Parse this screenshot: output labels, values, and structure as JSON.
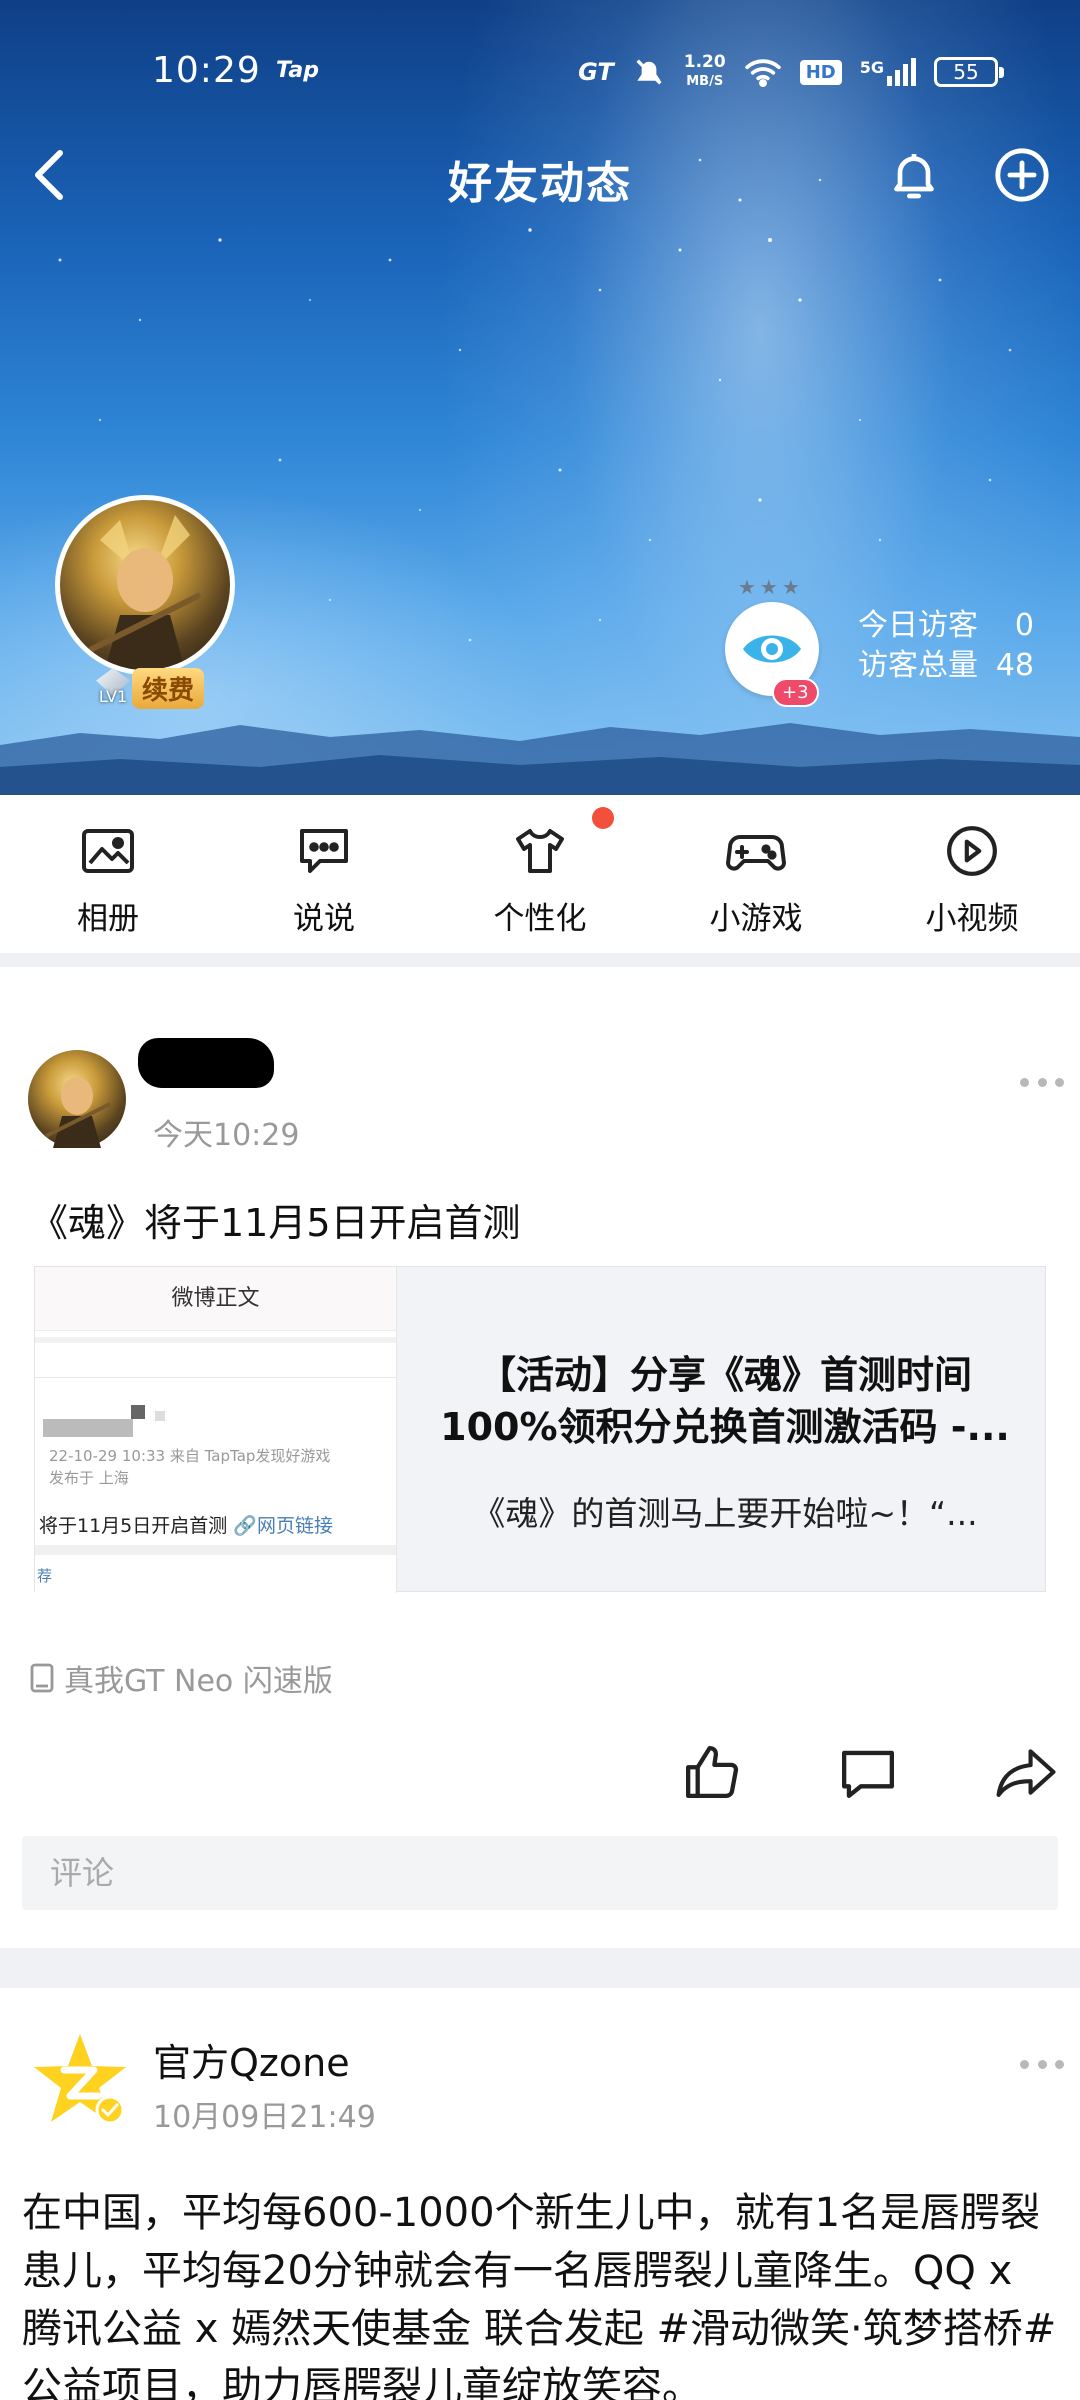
{
  "status_bar": {
    "time": "10:29",
    "app_tag": "Tap",
    "gt_label": "GT",
    "net_speed_value": "1.20",
    "net_speed_unit": "MB/S",
    "hd_label": "HD",
    "signal_label": "5G",
    "battery": "55"
  },
  "header": {
    "title": "好友动态"
  },
  "profile": {
    "level": "LV1",
    "renew_label": "续费",
    "visitor_badge": "+3",
    "today_visitors_label": "今日访客",
    "today_visitors_value": "0",
    "total_visitors_label": "访客总量",
    "total_visitors_value": "48"
  },
  "menu": [
    {
      "label": "相册",
      "icon": "image-icon"
    },
    {
      "label": "说说",
      "icon": "chat-bubble-icon"
    },
    {
      "label": "个性化",
      "icon": "tshirt-icon"
    },
    {
      "label": "小游戏",
      "icon": "gamepad-icon"
    },
    {
      "label": "小视频",
      "icon": "play-circle-icon"
    }
  ],
  "post1": {
    "time": "今天10:29",
    "text": "《魂》将于11月5日开启首测",
    "card": {
      "thumb_header": "微博正文",
      "thumb_meta": "22-10-29 10:33  来自 TapTap发现好游戏",
      "thumb_location": "发布于 上海",
      "thumb_line": "将于11月5日开启首测",
      "thumb_link": "🔗网页链接",
      "thumb_recommend": "荐",
      "title": "【活动】分享《魂》首测时间100%领积分兑换首测激活码 -...",
      "desc": "《魂》的首测马上要开始啦~！“..."
    },
    "device": "真我GT Neo 闪速版",
    "comment_placeholder": "评论"
  },
  "post2": {
    "author": "官方Qzone",
    "time": "10月09日21:49",
    "text": "在中国，平均每600-1000个新生儿中，就有1名是唇腭裂患儿，平均每20分钟就会有一名唇腭裂儿童降生。QQ x 腾讯公益 x 嫣然天使基金 联合发起 #滑动微笑·筑梦搭桥# 公益项目，助力唇腭裂儿童绽放笑容。"
  }
}
